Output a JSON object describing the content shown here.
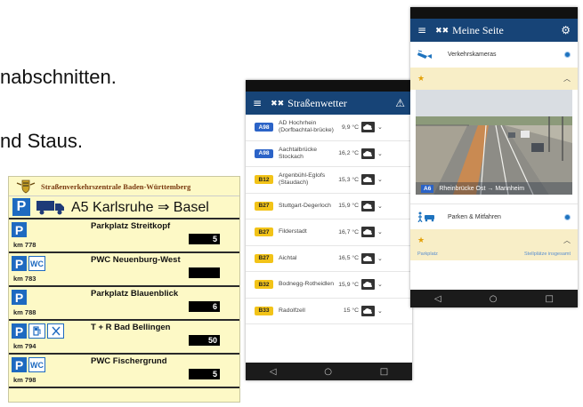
{
  "background_text": {
    "line1": "nabschnitten.",
    "line2": "nd Staus."
  },
  "parking_sign": {
    "header": "Straßenverkehrszentrale Baden-Württemberg",
    "route": "A5 Karlsruhe ⇒ Basel",
    "p_symbol": "P",
    "rows": [
      {
        "km": "km 778",
        "name": "Parkplatz Streitkopf",
        "count": "5",
        "icons": []
      },
      {
        "km": "km 783",
        "name": "PWC Neuenburg-West",
        "count": "",
        "icons": [
          "WC"
        ]
      },
      {
        "km": "km 788",
        "name": "Parkplatz Blauenblick",
        "count": "6",
        "icons": []
      },
      {
        "km": "km 794",
        "name": "T + R Bad Bellingen",
        "count": "50",
        "icons": [
          "fuel",
          "restaurant"
        ]
      },
      {
        "km": "km 798",
        "name": "PWC Fischergrund",
        "count": "5",
        "icons": [
          "WC"
        ]
      }
    ],
    "colors": {
      "background": "#fdf9c6",
      "p_blue": "#1e6ac0"
    }
  },
  "phone_weather": {
    "title": "Straßenwetter",
    "rows": [
      {
        "road": "A98",
        "name": "AD Hochrhein (Dorfbachtal-brücke)",
        "temp": "9,9 °C"
      },
      {
        "road": "A98",
        "name": "Aachtalbrücke Stockach",
        "temp": "16,2 °C"
      },
      {
        "road": "B12",
        "name": "Argenbühl-Eglofs (Staudach)",
        "temp": "15,3 °C"
      },
      {
        "road": "B27",
        "name": "Stuttgart-Degerloch",
        "temp": "15,9 °C"
      },
      {
        "road": "B27",
        "name": "Filderstadt",
        "temp": "16,7 °C"
      },
      {
        "road": "B27",
        "name": "Aichtal",
        "temp": "16,5 °C"
      },
      {
        "road": "B32",
        "name": "Bodnegg-Rotheidlen",
        "temp": "15,9 °C"
      },
      {
        "road": "B33",
        "name": "Radolfzell",
        "temp": "15 °C"
      }
    ],
    "colors": {
      "appbar": "#174477",
      "road_a": "#2b63c7",
      "road_b": "#f2c318"
    }
  },
  "phone_mypage": {
    "title": "Meine Seite",
    "cards": {
      "cameras": "Verkehrskameras",
      "parking": "Parken & Mitfahren"
    },
    "camera_caption": {
      "road": "A6",
      "text": "Rheinbrücke Ost → Mannheim"
    },
    "parking_tabs": {
      "left": "Parkplatz",
      "right": "Stellplätze insgesamt"
    }
  }
}
